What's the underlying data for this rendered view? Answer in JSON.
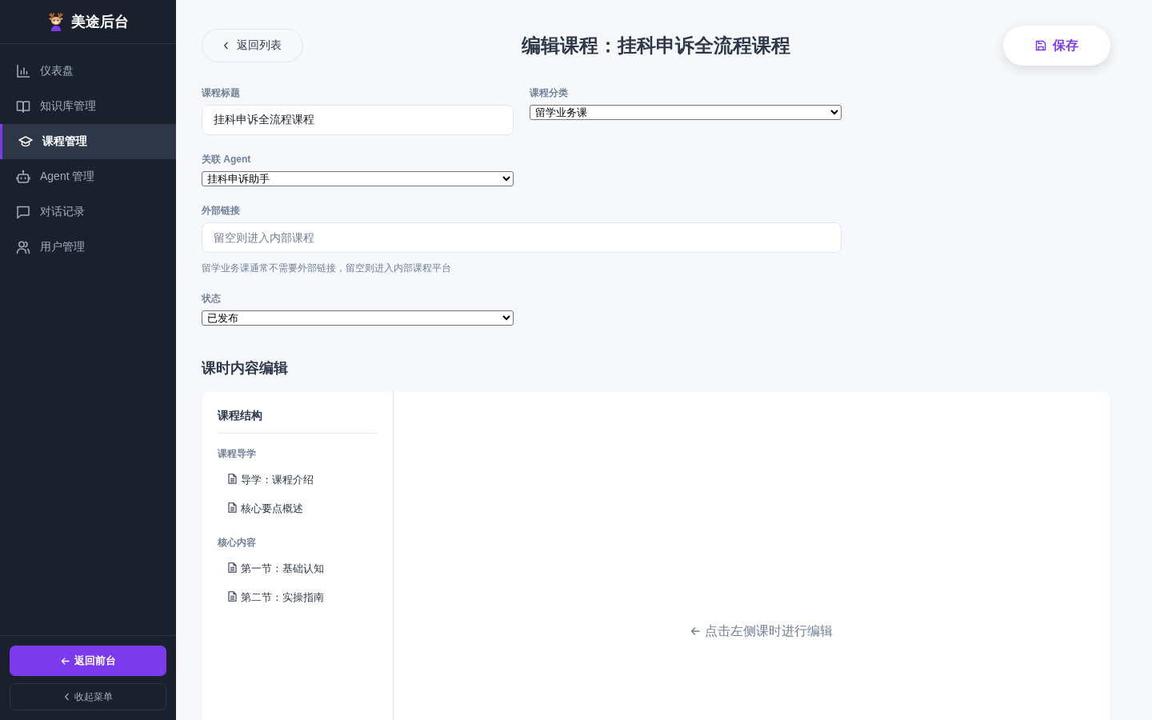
{
  "sidebar": {
    "brand": "美途后台",
    "nav": [
      {
        "label": "仪表盘",
        "selected": false
      },
      {
        "label": "知识库管理",
        "selected": false
      },
      {
        "label": "课程管理",
        "selected": true
      },
      {
        "label": "Agent 管理",
        "selected": false
      },
      {
        "label": "对话记录",
        "selected": false
      },
      {
        "label": "用户管理",
        "selected": false
      }
    ],
    "footer_buttons": [
      {
        "label": "返回前台",
        "kind": "primary"
      },
      {
        "label": "收起菜单",
        "kind": "outline"
      }
    ]
  },
  "header": {
    "back_button": "返回列表",
    "title": "编辑课程：挂科申诉全流程课程",
    "save_button": "保存"
  },
  "form": {
    "fields": [
      {
        "kind": "text",
        "label": "课程标题",
        "value": "挂科申诉全流程课程"
      },
      {
        "kind": "select",
        "label": "课程分类",
        "value": "留学业务课"
      },
      {
        "kind": "select",
        "label": "关联 Agent",
        "value": "挂科申诉助手"
      },
      {
        "kind": "url",
        "label": "外部链接",
        "placeholder": "留空则进入内部课程",
        "hint": "留学业务课通常不需要外部链接，留空则进入内部课程平台"
      },
      {
        "kind": "select",
        "label": "状态",
        "value": "已发布"
      }
    ]
  },
  "lessons": {
    "heading": "课时内容编辑",
    "outline": {
      "title": "课程结构",
      "groups": [
        {
          "label": "课程导学",
          "children": [
            {
              "label": "导学：课程介绍",
              "selected": false
            },
            {
              "label": "核心要点概述",
              "selected": false
            }
          ]
        },
        {
          "label": "核心内容",
          "children": [
            {
              "label": "第一节：基础认知",
              "selected": false
            },
            {
              "label": "第二节：实操指南",
              "selected": false
            }
          ]
        }
      ]
    },
    "editor": {
      "empty_message": "点击左侧课时进行编辑"
    }
  }
}
